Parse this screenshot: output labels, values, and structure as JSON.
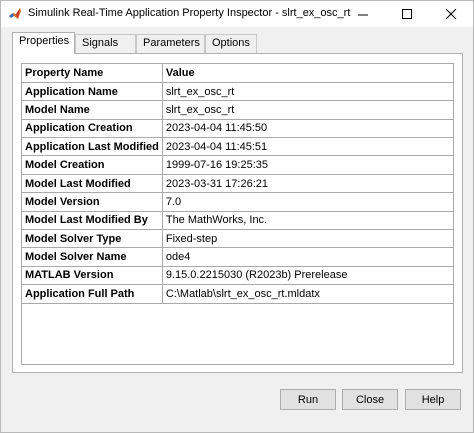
{
  "window": {
    "title": "Simulink Real-Time Application Property Inspector - slrt_ex_osc_rt",
    "icon": "matlab-logo-icon"
  },
  "tabs": [
    {
      "label": "Properties",
      "active": true
    },
    {
      "label": "Signals",
      "active": false
    },
    {
      "label": "Parameters",
      "active": false
    },
    {
      "label": "Options",
      "active": false
    }
  ],
  "table": {
    "headers": [
      "Property Name",
      "Value"
    ],
    "rows": [
      [
        "Application Name",
        "slrt_ex_osc_rt"
      ],
      [
        "Model Name",
        "slrt_ex_osc_rt"
      ],
      [
        "Application Creation",
        "2023-04-04 11:45:50"
      ],
      [
        "Application Last Modified",
        "2023-04-04 11:45:51"
      ],
      [
        "Model Creation",
        "1999-07-16 19:25:35"
      ],
      [
        "Model Last Modified",
        "2023-03-31 17:26:21"
      ],
      [
        "Model Version",
        "7.0"
      ],
      [
        "Model Last Modified By",
        "The MathWorks, Inc."
      ],
      [
        "Model Solver Type",
        "Fixed-step"
      ],
      [
        "Model Solver Name",
        "ode4"
      ],
      [
        "MATLAB Version",
        "9.15.0.2215030 (R2023b) Prerelease"
      ],
      [
        "Application Full Path",
        "C:\\Matlab\\slrt_ex_osc_rt.mldatx"
      ]
    ]
  },
  "buttons": {
    "run": "Run",
    "close": "Close",
    "help": "Help"
  }
}
